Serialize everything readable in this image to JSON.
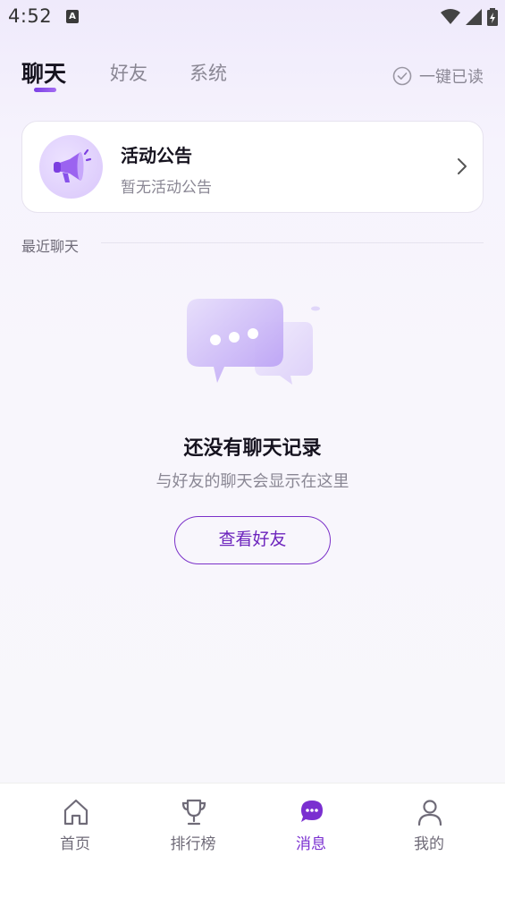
{
  "status_bar": {
    "time": "4:52",
    "notification_icon_letter": "A",
    "icons": [
      "wifi-icon",
      "signal-icon",
      "battery-icon"
    ]
  },
  "tabs": [
    {
      "label": "聊天",
      "active": true
    },
    {
      "label": "好友",
      "active": false
    },
    {
      "label": "系统",
      "active": false
    }
  ],
  "mark_all_read": {
    "label": "一键已读",
    "icon": "check-circle-icon"
  },
  "announcement": {
    "title": "活动公告",
    "subtitle": "暂无活动公告",
    "icon": "megaphone-icon"
  },
  "recent": {
    "title": "最近聊天"
  },
  "empty_state": {
    "title": "还没有聊天记录",
    "subtitle": "与好友的聊天会显示在这里",
    "button_label": "查看好友",
    "illustration": "chat-bubbles-illustration"
  },
  "bottom_nav": [
    {
      "label": "首页",
      "icon": "home-icon",
      "active": false
    },
    {
      "label": "排行榜",
      "icon": "trophy-icon",
      "active": false
    },
    {
      "label": "消息",
      "icon": "message-icon",
      "active": true
    },
    {
      "label": "我的",
      "icon": "profile-icon",
      "active": false
    }
  ],
  "colors": {
    "accent": "#7a2fd0",
    "text_primary": "#16131f",
    "text_secondary": "#8a8794"
  }
}
